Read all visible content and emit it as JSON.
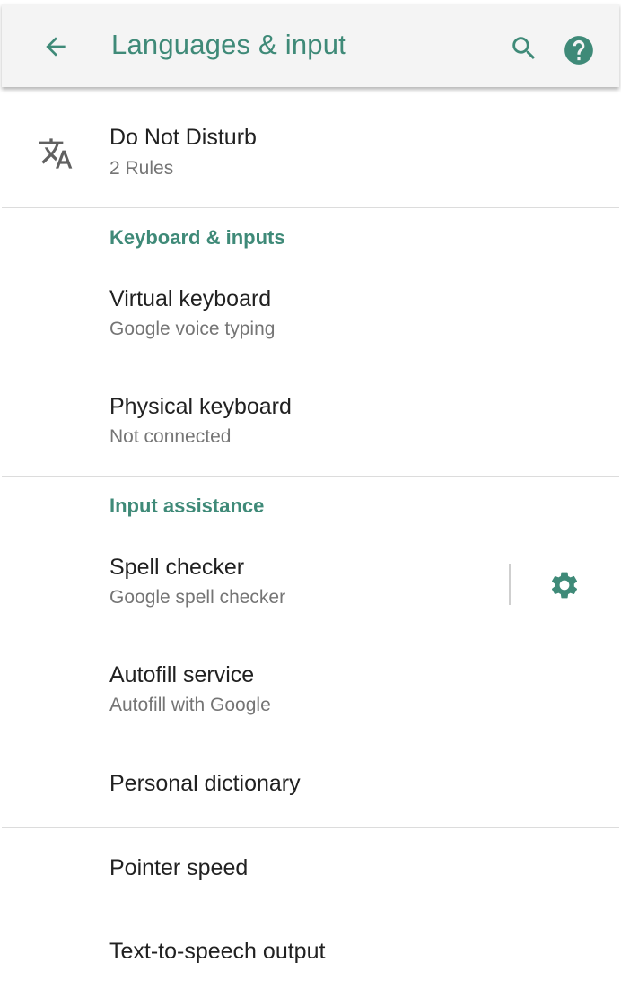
{
  "appbar": {
    "title": "Languages & input",
    "back_icon": "arrow-back-icon",
    "search_icon": "search-icon",
    "help_icon": "help-circle-icon"
  },
  "items": {
    "dnd": {
      "title": "Do Not Disturb",
      "subtitle": "2 Rules",
      "icon": "translate-icon"
    },
    "keyboard_header": "Keyboard & inputs",
    "virtual_keyboard": {
      "title": "Virtual keyboard",
      "subtitle": "Google voice typing"
    },
    "physical_keyboard": {
      "title": "Physical keyboard",
      "subtitle": "Not connected"
    },
    "assistance_header": "Input assistance",
    "spell_checker": {
      "title": "Spell checker",
      "subtitle": "Google spell checker",
      "action_icon": "gear-icon"
    },
    "autofill": {
      "title": "Autofill service",
      "subtitle": "Autofill with Google"
    },
    "dictionary": {
      "title": "Personal dictionary"
    },
    "pointer_speed": {
      "title": "Pointer speed"
    },
    "tts": {
      "title": "Text-to-speech output"
    }
  },
  "colors": {
    "accent": "#3f8a78",
    "title_text": "#212121",
    "subtitle_text": "#757575",
    "appbar_bg": "#f4f4f4"
  }
}
